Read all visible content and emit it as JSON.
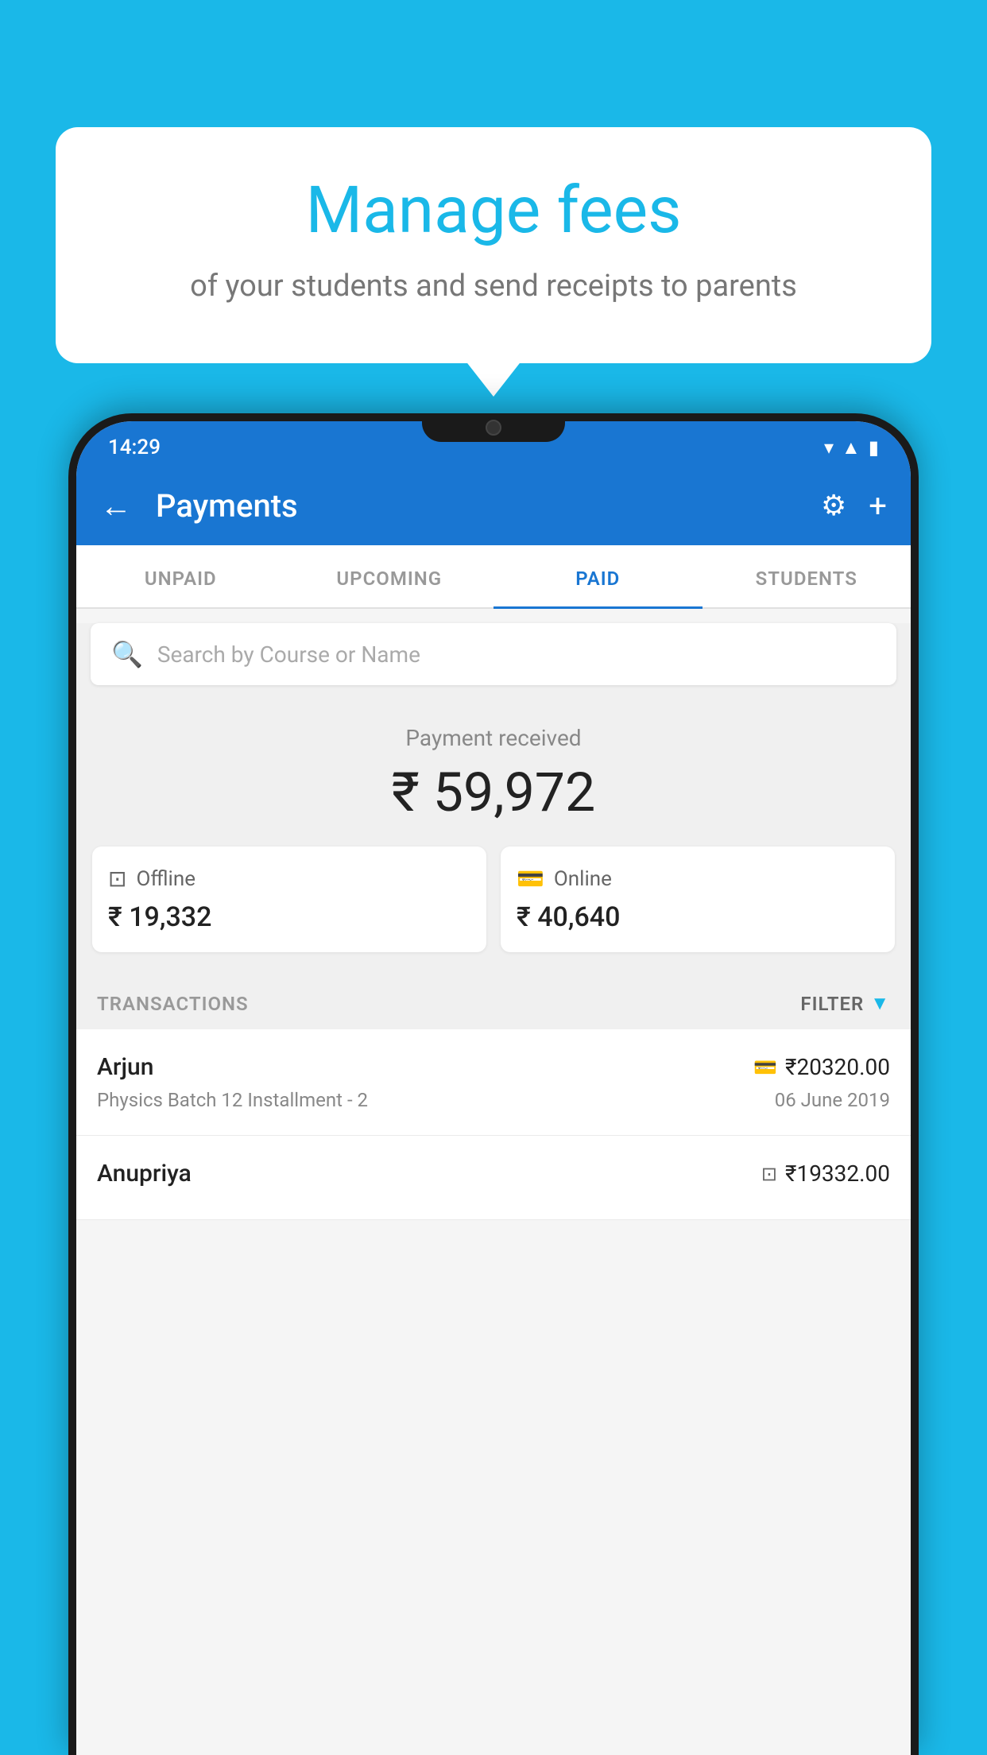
{
  "background_color": "#1ab8e8",
  "bubble": {
    "title": "Manage fees",
    "subtitle": "of your students and send receipts to parents"
  },
  "status_bar": {
    "time": "14:29",
    "icons": [
      "wifi",
      "signal",
      "battery"
    ]
  },
  "app_bar": {
    "title": "Payments",
    "back_label": "←",
    "settings_label": "⚙",
    "add_label": "+"
  },
  "tabs": [
    {
      "label": "UNPAID",
      "active": false
    },
    {
      "label": "UPCOMING",
      "active": false
    },
    {
      "label": "PAID",
      "active": true
    },
    {
      "label": "STUDENTS",
      "active": false
    }
  ],
  "search": {
    "placeholder": "Search by Course or Name"
  },
  "payment_summary": {
    "label": "Payment received",
    "total": "₹ 59,972",
    "offline_label": "Offline",
    "offline_amount": "₹ 19,332",
    "online_label": "Online",
    "online_amount": "₹ 40,640"
  },
  "transactions_section": {
    "label": "TRANSACTIONS",
    "filter_label": "FILTER"
  },
  "transactions": [
    {
      "name": "Arjun",
      "amount": "₹20320.00",
      "course": "Physics Batch 12 Installment - 2",
      "date": "06 June 2019",
      "payment_type": "online"
    },
    {
      "name": "Anupriya",
      "amount": "₹19332.00",
      "course": "",
      "date": "",
      "payment_type": "offline"
    }
  ],
  "colors": {
    "primary": "#1976d2",
    "accent": "#1ab8e8",
    "text_dark": "#222222",
    "text_medium": "#666666",
    "text_light": "#aaaaaa"
  }
}
